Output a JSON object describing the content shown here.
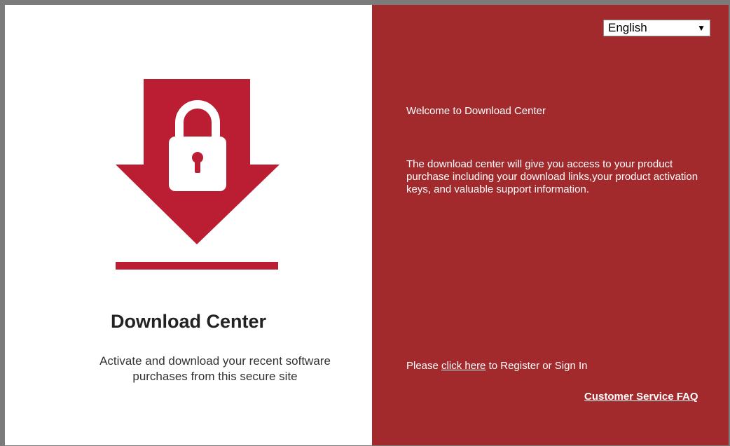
{
  "colors": {
    "brand_red": "#a32a2c",
    "icon_red": "#bb1e32",
    "background": "#ffffff"
  },
  "left_panel": {
    "icon": "download-lock-icon",
    "title": "Download Center",
    "subtitle": "Activate and download your recent software purchases from this secure site"
  },
  "right_panel": {
    "language_select": {
      "selected": "English"
    },
    "welcome": "Welcome to Download Center",
    "description": "The download center will give you access to your product purchase including your download links,your product activation keys, and valuable support information.",
    "register": {
      "prefix": "Please ",
      "link": "click here",
      "suffix": " to Register or Sign In"
    },
    "faq_link": "Customer Service FAQ"
  }
}
